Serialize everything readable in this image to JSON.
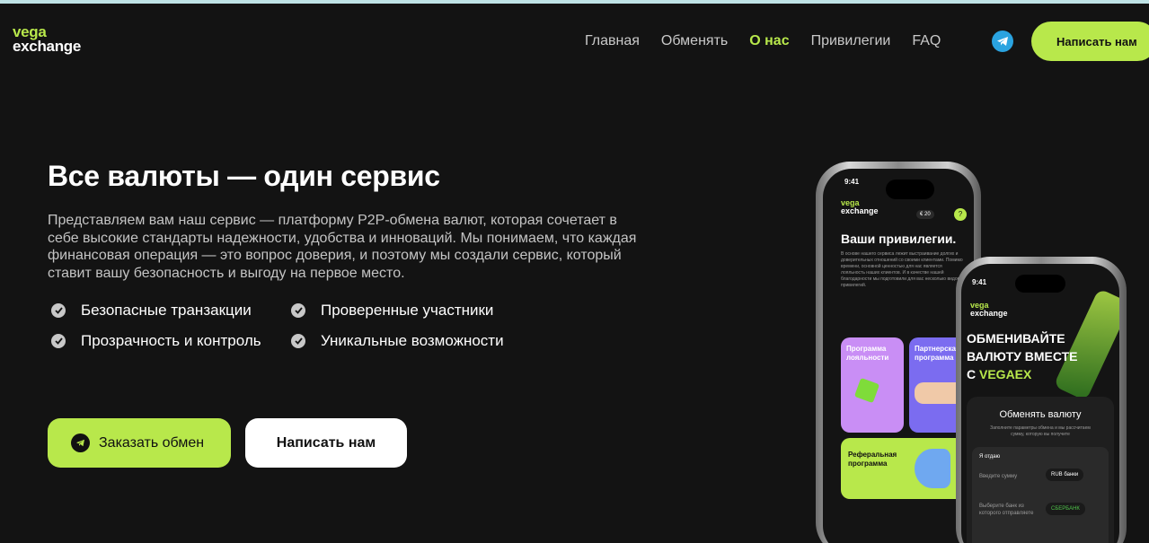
{
  "logo": {
    "line1": "vega",
    "line2": "exchange"
  },
  "nav": {
    "items": [
      {
        "label": "Главная",
        "active": false
      },
      {
        "label": "Обменять",
        "active": false
      },
      {
        "label": "О нас",
        "active": true
      },
      {
        "label": "Привилегии",
        "active": false
      },
      {
        "label": "FAQ",
        "active": false
      }
    ],
    "cta_label": "Написать нам"
  },
  "hero": {
    "title": "Все валюты — один сервис",
    "description": "Представляем вам наш сервис — платформу P2P-обмена валют, которая сочетает в себе высокие стандарты надежности, удобства и инноваций. Мы понимаем, что каждая финансовая операция — это вопрос доверия, и поэтому мы создали сервис, который ставит вашу безопасность и выгоду на первое место.",
    "features": [
      "Безопасные транзакции",
      "Проверенные участники",
      "Прозрачность и контроль",
      "Уникальные возможности"
    ],
    "order_button": "Заказать обмен",
    "write_button": "Написать нам"
  },
  "phone_left": {
    "time": "9:41",
    "logo_line1": "vega",
    "logo_line2": "exchange",
    "balance": "€ 20",
    "heading": "Ваши привилегии.",
    "body": "В основе нашего сервиса лежит выстраивание долгих и доверительных отношений со своими клиентами. Помимо времени, основной ценностью для нас является лояльность наших клиентов. И в качестве нашей благодарности мы подготовили для вас несколько видов привилегий.",
    "card1": "Программа лояльности",
    "card2": "Партнерская программа",
    "card3": "Реферальная программа"
  },
  "phone_right": {
    "time": "9:41",
    "logo_line1": "vega",
    "logo_line2": "exchange",
    "banner_line1": "ОБМЕНИВАЙТЕ",
    "banner_line2": "ВАЛЮТУ ВМЕСТЕ",
    "banner_line3_prefix": "С ",
    "banner_line3_brand": "VEGAEX",
    "panel_title": "Обменять валюту",
    "panel_sub": "Заполните параметры обмена и мы рассчитаем сумму, которую вы получите",
    "give_label": "Я отдаю",
    "amount_placeholder": "Введите сумму",
    "currency": "RUB банки",
    "bank_placeholder": "Выберите банк из которого отправляете",
    "bank": "СБЕРБАНК"
  },
  "colors": {
    "accent": "#b8e84b",
    "background": "#131313",
    "telegram": "#2aa3e0"
  }
}
